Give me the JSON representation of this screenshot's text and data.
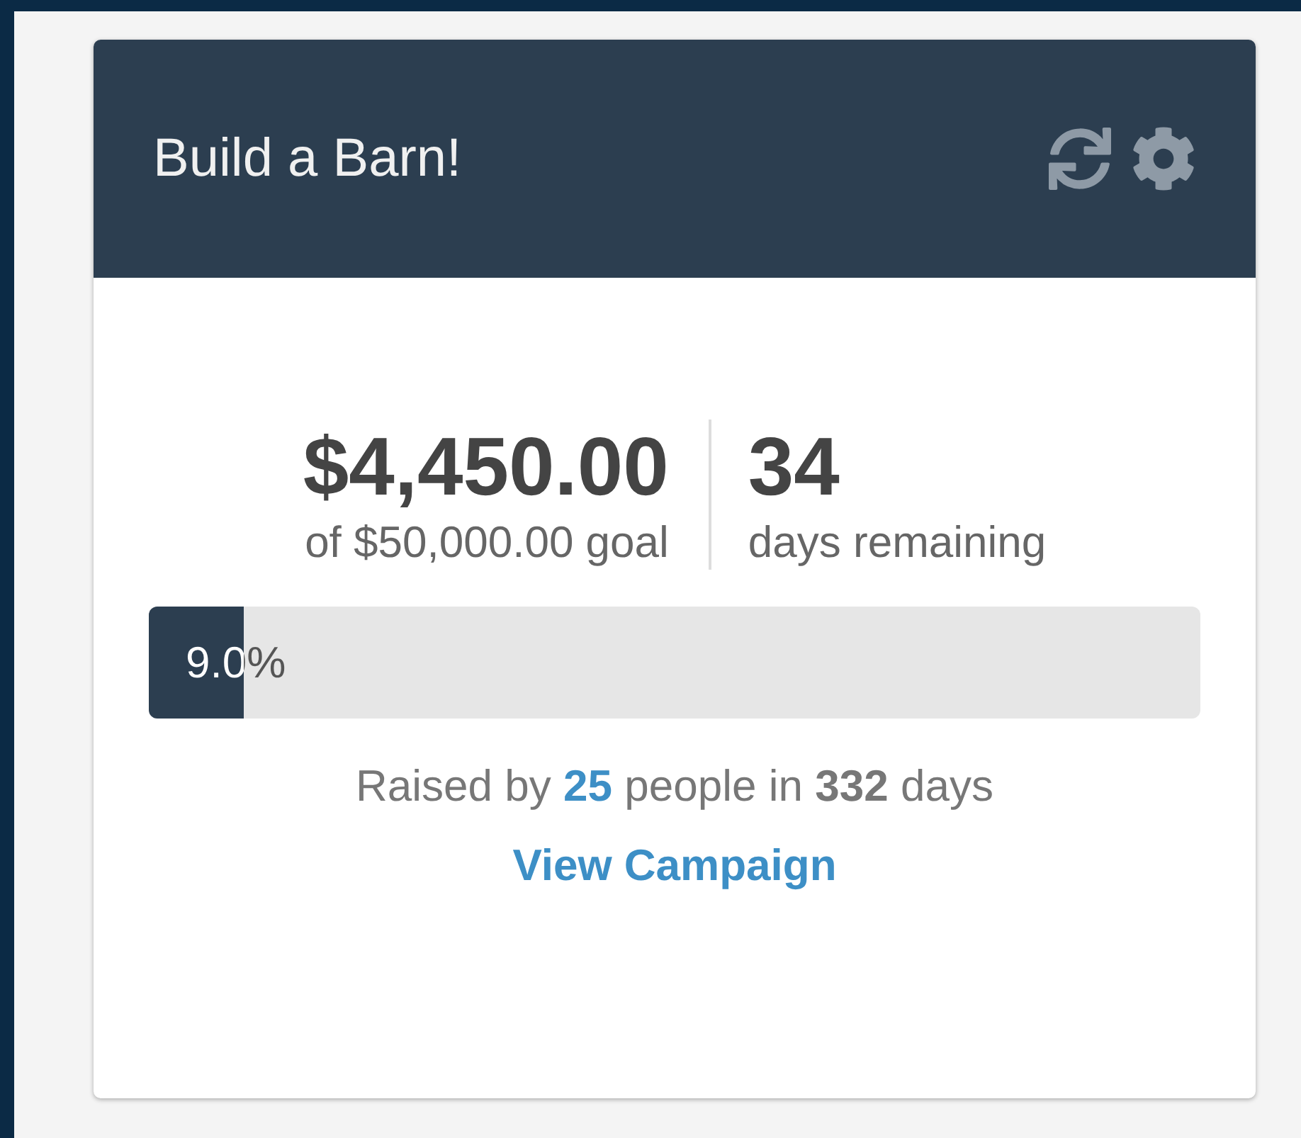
{
  "card": {
    "title": "Build a Barn!"
  },
  "raised": {
    "amount": "$4,450.00",
    "goal": "of $50,000.00 goal"
  },
  "remaining": {
    "days": "34",
    "label": "days remaining"
  },
  "progress": {
    "level": 0.09,
    "label": "9.0%"
  },
  "summary": {
    "prefix": "Raised by",
    "people": "25",
    "middle": "people in",
    "days": "332",
    "suffix": "days"
  },
  "link": "View Campaign"
}
